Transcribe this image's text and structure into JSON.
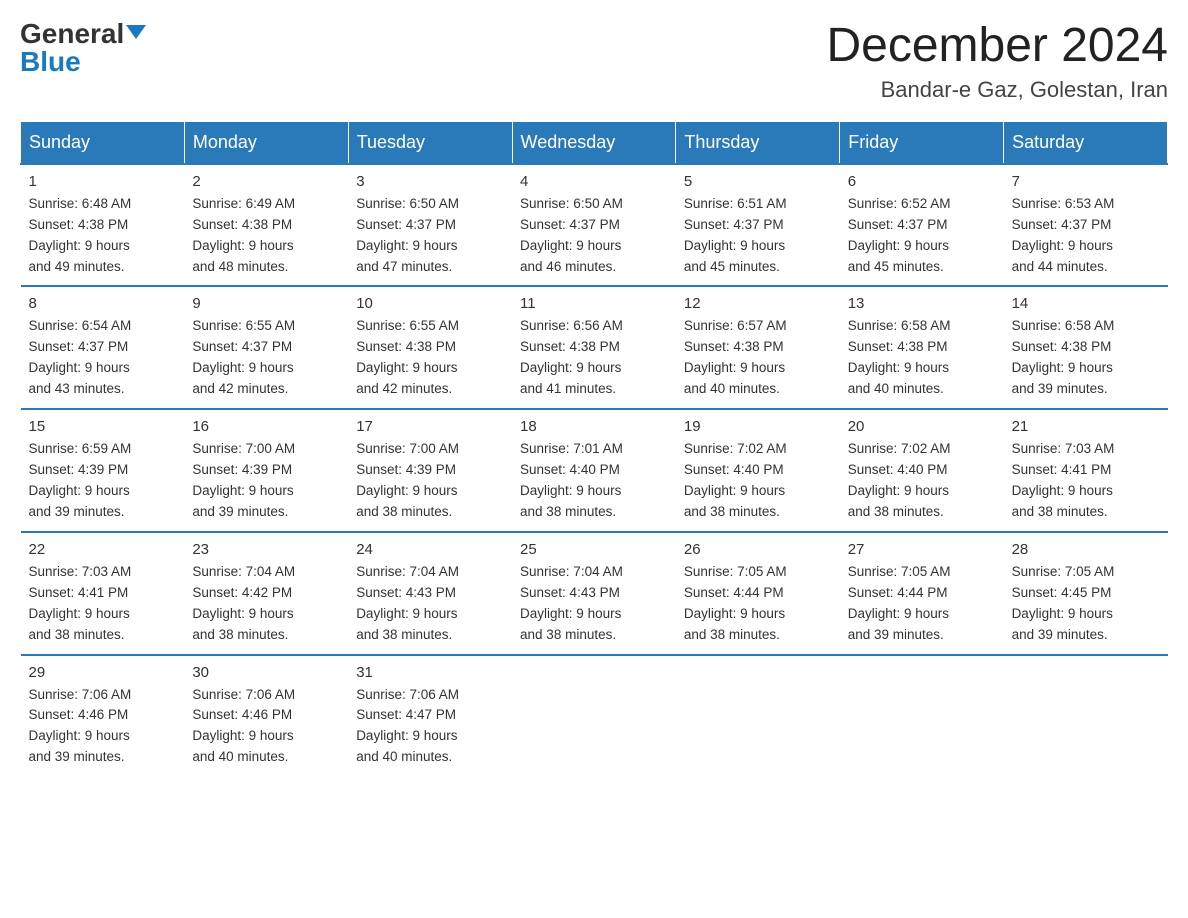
{
  "header": {
    "logo_general": "General",
    "logo_blue": "Blue",
    "month_title": "December 2024",
    "location": "Bandar-e Gaz, Golestan, Iran"
  },
  "weekdays": [
    "Sunday",
    "Monday",
    "Tuesday",
    "Wednesday",
    "Thursday",
    "Friday",
    "Saturday"
  ],
  "weeks": [
    [
      {
        "day": "1",
        "sunrise": "6:48 AM",
        "sunset": "4:38 PM",
        "daylight": "9 hours and 49 minutes."
      },
      {
        "day": "2",
        "sunrise": "6:49 AM",
        "sunset": "4:38 PM",
        "daylight": "9 hours and 48 minutes."
      },
      {
        "day": "3",
        "sunrise": "6:50 AM",
        "sunset": "4:37 PM",
        "daylight": "9 hours and 47 minutes."
      },
      {
        "day": "4",
        "sunrise": "6:50 AM",
        "sunset": "4:37 PM",
        "daylight": "9 hours and 46 minutes."
      },
      {
        "day": "5",
        "sunrise": "6:51 AM",
        "sunset": "4:37 PM",
        "daylight": "9 hours and 45 minutes."
      },
      {
        "day": "6",
        "sunrise": "6:52 AM",
        "sunset": "4:37 PM",
        "daylight": "9 hours and 45 minutes."
      },
      {
        "day": "7",
        "sunrise": "6:53 AM",
        "sunset": "4:37 PM",
        "daylight": "9 hours and 44 minutes."
      }
    ],
    [
      {
        "day": "8",
        "sunrise": "6:54 AM",
        "sunset": "4:37 PM",
        "daylight": "9 hours and 43 minutes."
      },
      {
        "day": "9",
        "sunrise": "6:55 AM",
        "sunset": "4:37 PM",
        "daylight": "9 hours and 42 minutes."
      },
      {
        "day": "10",
        "sunrise": "6:55 AM",
        "sunset": "4:38 PM",
        "daylight": "9 hours and 42 minutes."
      },
      {
        "day": "11",
        "sunrise": "6:56 AM",
        "sunset": "4:38 PM",
        "daylight": "9 hours and 41 minutes."
      },
      {
        "day": "12",
        "sunrise": "6:57 AM",
        "sunset": "4:38 PM",
        "daylight": "9 hours and 40 minutes."
      },
      {
        "day": "13",
        "sunrise": "6:58 AM",
        "sunset": "4:38 PM",
        "daylight": "9 hours and 40 minutes."
      },
      {
        "day": "14",
        "sunrise": "6:58 AM",
        "sunset": "4:38 PM",
        "daylight": "9 hours and 39 minutes."
      }
    ],
    [
      {
        "day": "15",
        "sunrise": "6:59 AM",
        "sunset": "4:39 PM",
        "daylight": "9 hours and 39 minutes."
      },
      {
        "day": "16",
        "sunrise": "7:00 AM",
        "sunset": "4:39 PM",
        "daylight": "9 hours and 39 minutes."
      },
      {
        "day": "17",
        "sunrise": "7:00 AM",
        "sunset": "4:39 PM",
        "daylight": "9 hours and 38 minutes."
      },
      {
        "day": "18",
        "sunrise": "7:01 AM",
        "sunset": "4:40 PM",
        "daylight": "9 hours and 38 minutes."
      },
      {
        "day": "19",
        "sunrise": "7:02 AM",
        "sunset": "4:40 PM",
        "daylight": "9 hours and 38 minutes."
      },
      {
        "day": "20",
        "sunrise": "7:02 AM",
        "sunset": "4:40 PM",
        "daylight": "9 hours and 38 minutes."
      },
      {
        "day": "21",
        "sunrise": "7:03 AM",
        "sunset": "4:41 PM",
        "daylight": "9 hours and 38 minutes."
      }
    ],
    [
      {
        "day": "22",
        "sunrise": "7:03 AM",
        "sunset": "4:41 PM",
        "daylight": "9 hours and 38 minutes."
      },
      {
        "day": "23",
        "sunrise": "7:04 AM",
        "sunset": "4:42 PM",
        "daylight": "9 hours and 38 minutes."
      },
      {
        "day": "24",
        "sunrise": "7:04 AM",
        "sunset": "4:43 PM",
        "daylight": "9 hours and 38 minutes."
      },
      {
        "day": "25",
        "sunrise": "7:04 AM",
        "sunset": "4:43 PM",
        "daylight": "9 hours and 38 minutes."
      },
      {
        "day": "26",
        "sunrise": "7:05 AM",
        "sunset": "4:44 PM",
        "daylight": "9 hours and 38 minutes."
      },
      {
        "day": "27",
        "sunrise": "7:05 AM",
        "sunset": "4:44 PM",
        "daylight": "9 hours and 39 minutes."
      },
      {
        "day": "28",
        "sunrise": "7:05 AM",
        "sunset": "4:45 PM",
        "daylight": "9 hours and 39 minutes."
      }
    ],
    [
      {
        "day": "29",
        "sunrise": "7:06 AM",
        "sunset": "4:46 PM",
        "daylight": "9 hours and 39 minutes."
      },
      {
        "day": "30",
        "sunrise": "7:06 AM",
        "sunset": "4:46 PM",
        "daylight": "9 hours and 40 minutes."
      },
      {
        "day": "31",
        "sunrise": "7:06 AM",
        "sunset": "4:47 PM",
        "daylight": "9 hours and 40 minutes."
      },
      null,
      null,
      null,
      null
    ]
  ]
}
